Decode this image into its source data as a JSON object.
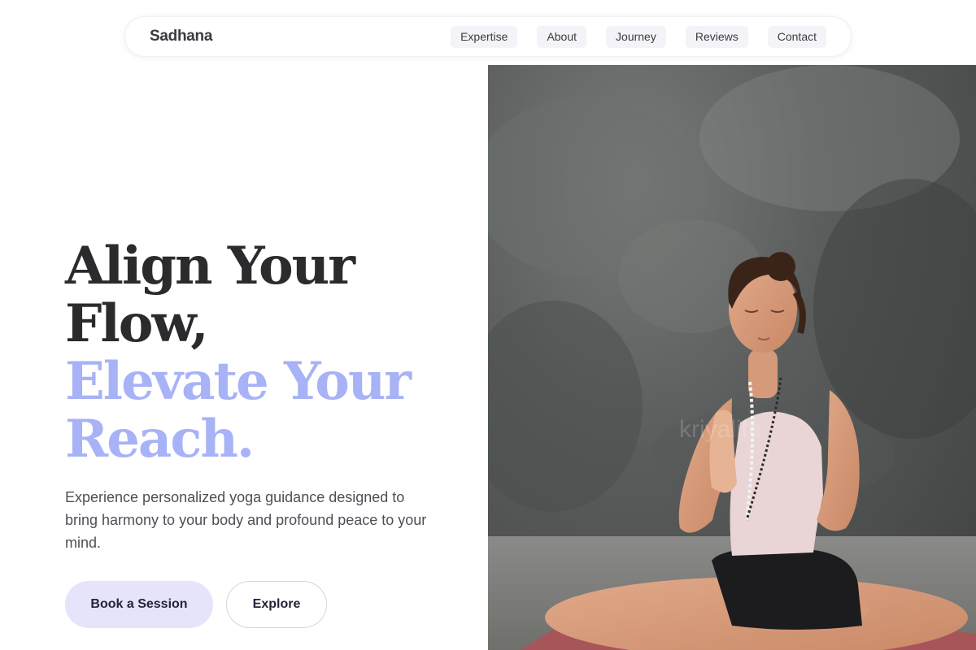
{
  "header": {
    "brand": "Sadhana",
    "nav": [
      {
        "label": "Expertise"
      },
      {
        "label": "About"
      },
      {
        "label": "Journey"
      },
      {
        "label": "Reviews"
      },
      {
        "label": "Contact"
      }
    ]
  },
  "hero": {
    "headline_line1": "Align Your",
    "headline_line2": "Flow,",
    "headline_line3": "Elevate Your",
    "headline_line4": "Reach.",
    "subtitle": "Experience personalized yoga guidance designed to bring harmony to your body and profound peace to your mind.",
    "primary_button": "Book a Session",
    "secondary_button": "Explore"
  },
  "image": {
    "subject": "woman meditating in lotus pose with prayer hands",
    "watermark": "kriyalife"
  },
  "colors": {
    "accent": "#a7b2f7",
    "primary_button_bg": "#e6e4fb",
    "nav_pill_bg": "#f4f3f8",
    "heading_dark": "#2b2b2e"
  }
}
